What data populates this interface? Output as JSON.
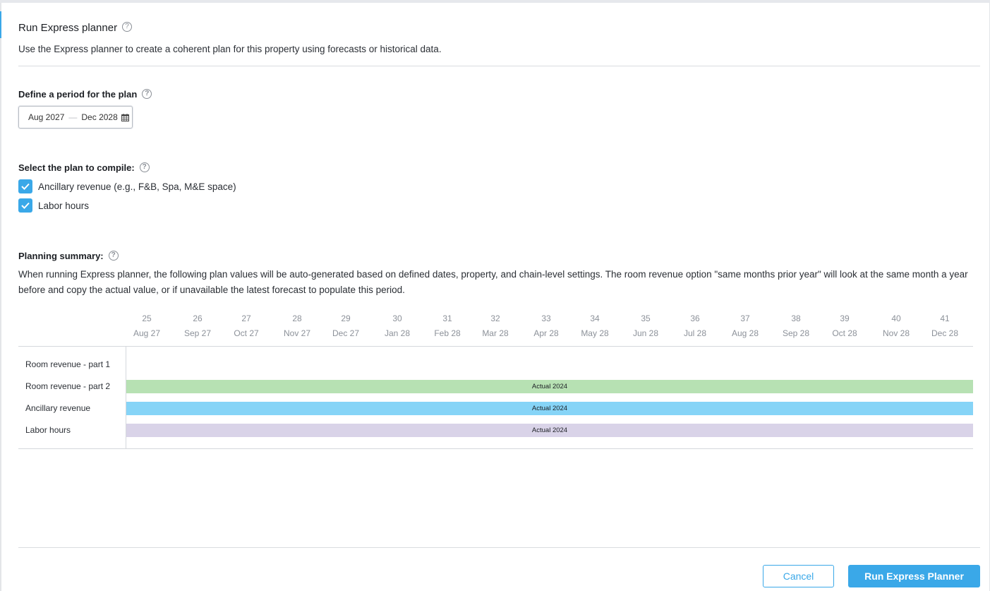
{
  "header": {
    "title": "Run Express planner",
    "subtitle": "Use the Express planner to create a coherent plan for this property using forecasts or historical data."
  },
  "period": {
    "label": "Define a period for the plan",
    "start": "Aug 2027",
    "separator": "—",
    "end": "Dec 2028",
    "icon": "calendar-icon"
  },
  "compile": {
    "label": "Select the plan to compile:",
    "options": [
      {
        "label": "Ancillary revenue (e.g., F&B, Spa, M&E space)",
        "checked": true
      },
      {
        "label": "Labor hours",
        "checked": true
      }
    ]
  },
  "summary": {
    "label": "Planning summary:",
    "text": "When running Express planner, the following plan values will be auto-generated based on defined dates, property, and chain-level settings. The room revenue option \"same months prior year\" will look at the same month a year before and copy the actual value, or if unavailable the latest forecast to populate this period."
  },
  "timeline": {
    "columns": [
      {
        "week": "25",
        "month": "Aug 27"
      },
      {
        "week": "26",
        "month": "Sep 27"
      },
      {
        "week": "27",
        "month": "Oct 27"
      },
      {
        "week": "28",
        "month": "Nov 27"
      },
      {
        "week": "29",
        "month": "Dec 27"
      },
      {
        "week": "30",
        "month": "Jan 28"
      },
      {
        "week": "31",
        "month": "Feb 28"
      },
      {
        "week": "32",
        "month": "Mar 28"
      },
      {
        "week": "33",
        "month": "Apr 28"
      },
      {
        "week": "34",
        "month": "May 28"
      },
      {
        "week": "35",
        "month": "Jun 28"
      },
      {
        "week": "36",
        "month": "Jul 28"
      },
      {
        "week": "37",
        "month": "Aug 28"
      },
      {
        "week": "38",
        "month": "Sep 28"
      },
      {
        "week": "39",
        "month": "Oct 28"
      },
      {
        "week": "40",
        "month": "Nov 28"
      },
      {
        "week": "41",
        "month": "Dec 28"
      }
    ],
    "rows": [
      {
        "label": "Room revenue - part 1",
        "bar": null
      },
      {
        "label": "Room revenue - part 2",
        "bar": {
          "text": "Actual 2024",
          "color": "#b7e1b3"
        }
      },
      {
        "label": "Ancillary revenue",
        "bar": {
          "text": "Actual 2024",
          "color": "#86d4f7"
        }
      },
      {
        "label": "Labor hours",
        "bar": {
          "text": "Actual 2024",
          "color": "#d9d3e8"
        }
      }
    ]
  },
  "buttons": {
    "cancel": "Cancel",
    "run": "Run Express Planner"
  },
  "colors": {
    "accent": "#3aa8e8"
  }
}
